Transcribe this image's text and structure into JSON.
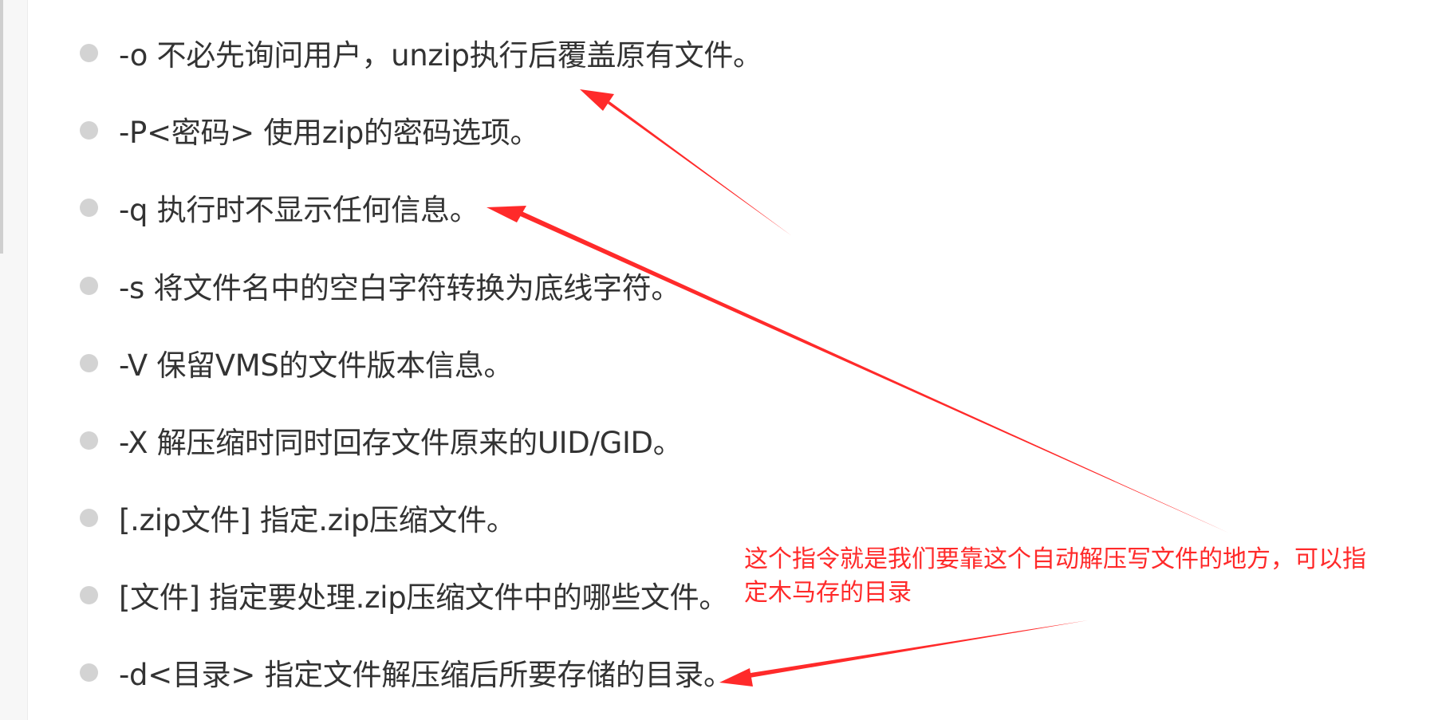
{
  "options": [
    {
      "text": "-o 不必先询问用户，unzip执行后覆盖原有文件。"
    },
    {
      "text": "-P<密码> 使用zip的密码选项。"
    },
    {
      "text": "-q 执行时不显示任何信息。"
    },
    {
      "text": "-s 将文件名中的空白字符转换为底线字符。"
    },
    {
      "text": "-V 保留VMS的文件版本信息。"
    },
    {
      "text": "-X 解压缩时同时回存文件原来的UID/GID。"
    },
    {
      "text": "[.zip文件] 指定.zip压缩文件。"
    },
    {
      "text": "[文件] 指定要处理.zip压缩文件中的哪些文件。"
    },
    {
      "text": "-d<目录> 指定文件解压缩后所要存储的目录。"
    }
  ],
  "annotation": {
    "line1": "这个指令就是我们要靠这个自动解压写文件的地方，可以指",
    "line2": "定木马存的目录",
    "color": "#ff2a2a"
  },
  "colors": {
    "text": "#333333",
    "bullet": "#d3d3d3",
    "annotation": "#ff2a2a"
  }
}
